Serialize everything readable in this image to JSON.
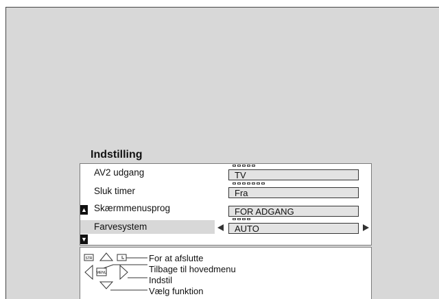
{
  "menu": {
    "title": "Indstilling",
    "rows": [
      {
        "label": "AV2 udgang",
        "value": "TV",
        "dots": 5
      },
      {
        "label": "Sluk timer",
        "value": "Fra",
        "dots": 7
      },
      {
        "label": "Skærmmenusprog",
        "value": "FOR ADGANG",
        "dots": 0
      },
      {
        "label": "Farvesystem",
        "value": "AUTO",
        "dots": 4
      }
    ]
  },
  "help": {
    "exit": "For at afslutte",
    "back": "Tilbage til hovedmenu",
    "adjust": "Indstil",
    "select": "Vælg funktion",
    "key_str": "STR",
    "key_menu": "MENU"
  }
}
